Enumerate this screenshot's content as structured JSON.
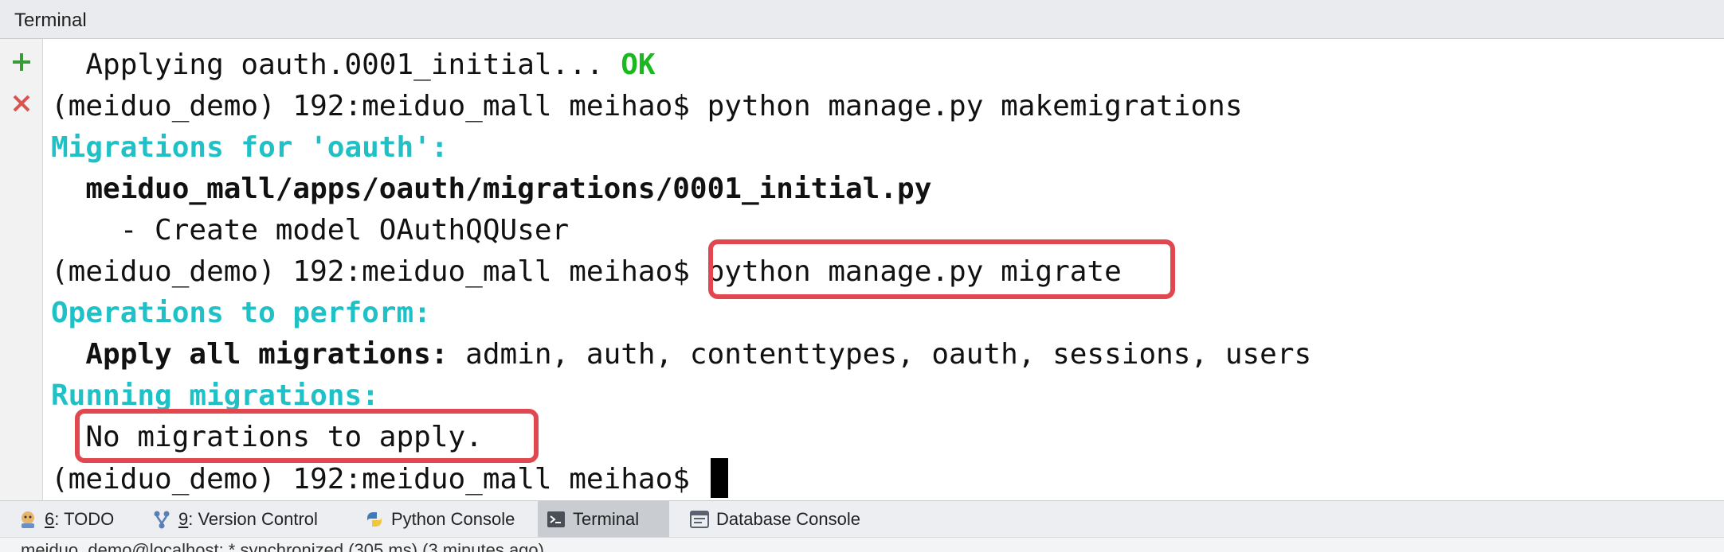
{
  "window": {
    "title": "Terminal"
  },
  "gutter": {
    "new_session_icon": "plus-icon",
    "close_session_icon": "close-icon"
  },
  "terminal": {
    "line1": {
      "text": "  Applying oauth.0001_initial... ",
      "ok": "OK"
    },
    "line2": {
      "prompt": "(meiduo_demo) 192:meiduo_mall meihao$ ",
      "cmd": "python manage.py makemigrations"
    },
    "line3": "Migrations for 'oauth':",
    "line4": "  meiduo_mall/apps/oauth/migrations/0001_initial.py",
    "line5": "    - Create model OAuthQQUser",
    "line6": {
      "prompt": "(meiduo_demo) 192:meiduo_mall meihao$ ",
      "cmd": "python manage.py migrate"
    },
    "line7": "Operations to perform:",
    "line8": {
      "label": "  Apply all migrations:",
      "apps": " admin, auth, contenttypes, oauth, sessions, users"
    },
    "line9": "Running migrations:",
    "line10": "  No migrations to apply.",
    "line11": {
      "prompt": "(meiduo_demo) 192:meiduo_mall meihao$ "
    }
  },
  "colors": {
    "ok_green": "#1bb91f",
    "cyan": "#1fc0c6",
    "highlight_red": "#e0474f"
  },
  "toolbar": {
    "todo": {
      "num": "6",
      "label": ": TODO"
    },
    "vcs": {
      "num": "9",
      "label": ": Version Control"
    },
    "python_console": "Python Console",
    "terminal": "Terminal",
    "database_console": "Database Console"
  },
  "status": {
    "text": "meiduo_demo@localhost: * synchronized (305 ms) (3 minutes ago)"
  }
}
